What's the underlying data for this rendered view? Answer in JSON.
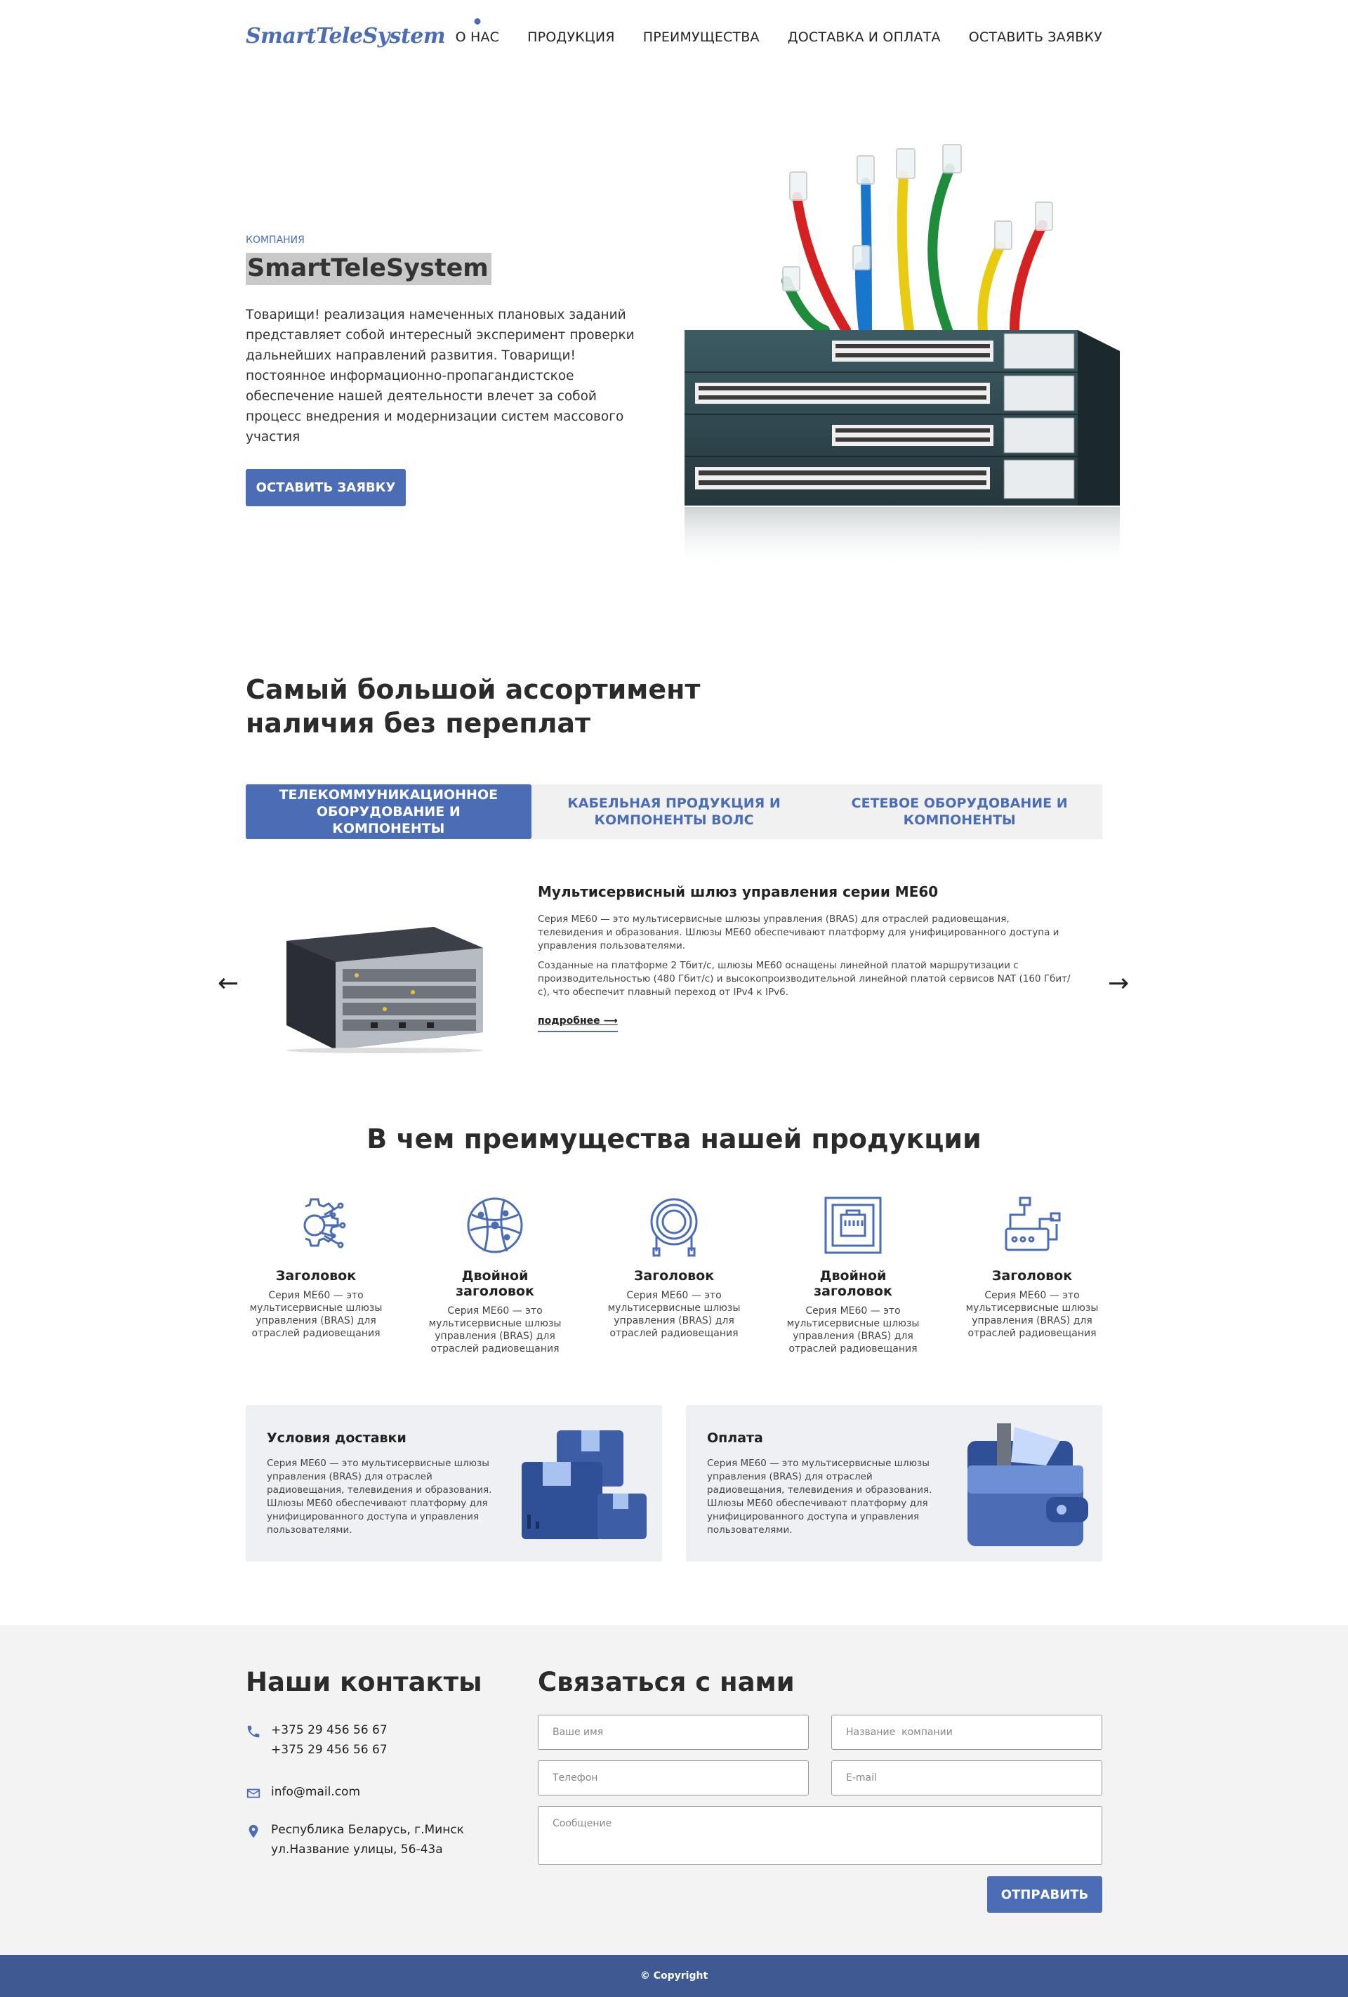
{
  "header": {
    "logo": "SmartTeleSystem",
    "nav": [
      "О НАС",
      "ПРОДУКЦИЯ",
      "ПРЕИМУЩЕСТВА",
      "ДОСТАВКА И ОПЛАТА",
      "ОСТАВИТЬ ЗАЯВКУ"
    ]
  },
  "hero": {
    "tag": "КОМПАНИЯ",
    "title": "SmartTeleSystem",
    "text": "Товарищи! реализация намеченных плановых заданий представляет собой интересный эксперимент проверки дальнейших направлений развития. Товарищи! постоянное информационно-пропагандистское обеспечение нашей деятельности влечет за собой процесс внедрения и модернизации систем массового участия",
    "button": "ОСТАВИТЬ ЗАЯВКУ"
  },
  "assortment": {
    "title": "Самый большой ассортимент наличия без переплат",
    "tabs": [
      "ТЕЛЕКОММУНИКАЦИОННОЕ ОБОРУДОВАНИЕ И КОМПОНЕНТЫ",
      "КАБЕЛЬНАЯ ПРОДУКЦИЯ И КОМПОНЕНТЫ ВОЛС",
      "СЕТЕВОЕ ОБОРУДОВАНИЕ И КОМПОНЕНТЫ"
    ],
    "active_tab": 0,
    "product": {
      "title": "Мультисервисный шлюз управления серии МЕ60",
      "p1": "Серия ME60 — это мультисервисные шлюзы управления (BRAS) для отраслей радиовещания, телевидения и образования. Шлюзы ME60 обеспечивают платформу для унифицированного доступа и управления пользователями.",
      "p2": "Созданные на платформе 2 Тбит/с, шлюзы ME60 оснащены линейной платой маршрутизации с производительностью (480 Гбит/с) и высокопроизводительной линейной платой сервисов NAT (160 Гбит/с), что обеспечит плавный переход от IPv4 к IPv6.",
      "more": "подробнее",
      "prev": "←",
      "next": "→"
    }
  },
  "advantages": {
    "title": "В чем преимущества нашей продукции",
    "items": [
      {
        "title": "Заголовок",
        "text": "Серия ME60 — это мультисервисные шлюзы управления (BRAS) для отраслей радиовещания",
        "icon": "gear-network-icon"
      },
      {
        "title": "Двойной заголовок",
        "text": "Серия ME60 — это мультисервисные шлюзы управления (BRAS) для отраслей радиовещания",
        "icon": "globe-network-icon"
      },
      {
        "title": "Заголовок",
        "text": "Серия ME60 — это мультисервисные шлюзы управления (BRAS) для отраслей радиовещания",
        "icon": "cable-coil-icon"
      },
      {
        "title": "Двойной заголовок",
        "text": "Серия ME60 — это мультисервисные шлюзы управления (BRAS) для отраслей радиовещания",
        "icon": "ethernet-port-icon"
      },
      {
        "title": "Заголовок",
        "text": "Серия ME60 — это мультисервисные шлюзы управления (BRAS) для отраслей радиовещания",
        "icon": "router-icon"
      }
    ]
  },
  "cards": {
    "delivery": {
      "title": "Условия доставки",
      "text": "Серия ME60 — это мультисервисные шлюзы управления (BRAS) для отраслей радиовещания, телевидения и образования. Шлюзы ME60 обеспечивают платформу для унифицированного доступа и управления пользователями."
    },
    "payment": {
      "title": "Оплата",
      "text": "Серия ME60 — это мультисервисные шлюзы управления (BRAS) для отраслей радиовещания, телевидения и образования. Шлюзы ME60 обеспечивают платформу для унифицированного доступа и управления пользователями."
    }
  },
  "contacts": {
    "title": "Наши контакты",
    "phone1": "+375 29 456 56 67",
    "phone2": "+375 29 456 56 67",
    "email": "info@mail.com",
    "address1": "Республика Беларусь, г.Минск",
    "address2": "ул.Название улицы, 56-43а"
  },
  "form": {
    "title": "Связаться с нами",
    "name_placeholder": "Ваше имя",
    "company_placeholder": "Название  компании",
    "phone_placeholder": "Телефон",
    "email_placeholder": "E-mail",
    "message_placeholder": "Сообщение",
    "submit": "ОТПРАВИТЬ"
  },
  "footer": {
    "copyright": "© Copyright"
  },
  "colors": {
    "accent": "#4a6db5",
    "footer": "#3f5a93",
    "section_bg": "#f3f3f3"
  }
}
